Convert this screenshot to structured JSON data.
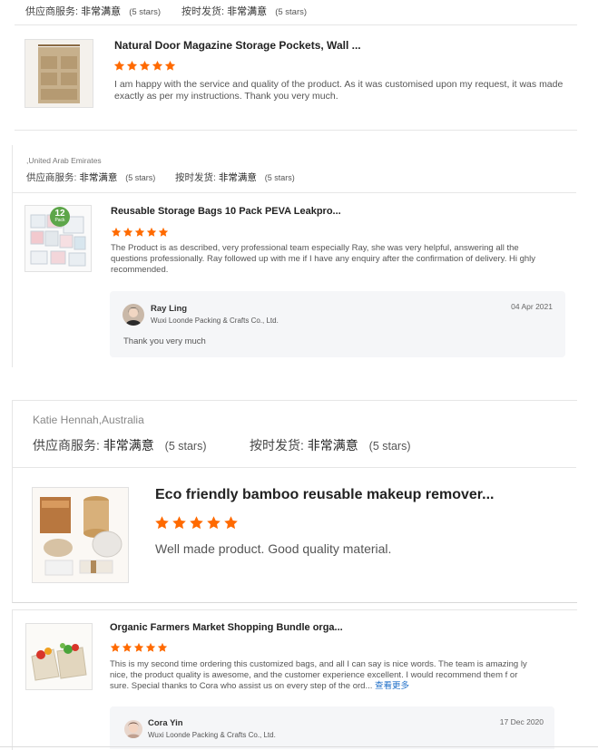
{
  "colors": {
    "star": "#ff6a00",
    "link": "#1f6fc8",
    "border": "#e6e6e6",
    "reply_bg": "#f5f6f8"
  },
  "reviews": [
    {
      "buyer": "",
      "supplier_label": "供应商服务:",
      "supplier_value": "非常满意",
      "supplier_stars": "(5 stars)",
      "delivery_label": "按时发货:",
      "delivery_value": "非常满意",
      "delivery_stars": "(5 stars)",
      "product_title": "Natural Door Magazine Storage Pockets, Wall ...",
      "rating": 5,
      "thumb_icon": "hanging-organizer-image",
      "text": "I am happy with the service and quality of the product. As it was customised upon my request, it was made exactly as per my instructions. Thank you very much."
    },
    {
      "buyer": ",United Arab Emirates",
      "supplier_label": "供应商服务:",
      "supplier_value": "非常满意",
      "supplier_stars": "(5 stars)",
      "delivery_label": "按时发货:",
      "delivery_value": "非常满意",
      "delivery_stars": "(5 stars)",
      "product_title": "Reusable Storage Bags 10 Pack PEVA Leakpro...",
      "rating": 5,
      "thumb_icon": "storage-bags-image",
      "thumb_badge": "12",
      "thumb_badge_sub": "Pack",
      "text": "The Product is as described, very professional team especially Ray, she was very helpful, answering all the questions professionally. Ray followed up with me if I have any enquiry after the confirmation of delivery. Hi ghly recommended.",
      "reply": {
        "name": "Ray Ling",
        "company": "Wuxi Loonde Packing & Crafts Co., Ltd.",
        "date": "04 Apr 2021",
        "text": "Thank you very much"
      }
    },
    {
      "buyer": "Katie Hennah,Australia",
      "supplier_label": "供应商服务:",
      "supplier_value": "非常满意",
      "supplier_stars": "(5 stars)",
      "delivery_label": "按时发货:",
      "delivery_value": "非常满意",
      "delivery_stars": "(5 stars)",
      "product_title": "Eco friendly bamboo reusable makeup remover...",
      "rating": 5,
      "thumb_icon": "bamboo-makeup-kit-image",
      "text": "Well made product. Good quality material."
    },
    {
      "buyer": "",
      "product_title": "Organic Farmers Market Shopping Bundle orga...",
      "rating": 5,
      "thumb_icon": "produce-bags-image",
      "text": "This is my second time ordering this customized bags, and all I can say is nice words. The team is amazing ly nice, the product quality is awesome, and the customer experience excellent. I would recommend them f or sure. Special thanks to Cora who assist us on every step of the ord...",
      "more_label": "查看更多",
      "reply": {
        "name": "Cora Yin",
        "company": "Wuxi Loonde Packing & Crafts Co., Ltd.",
        "date": "17 Dec 2020"
      }
    }
  ]
}
